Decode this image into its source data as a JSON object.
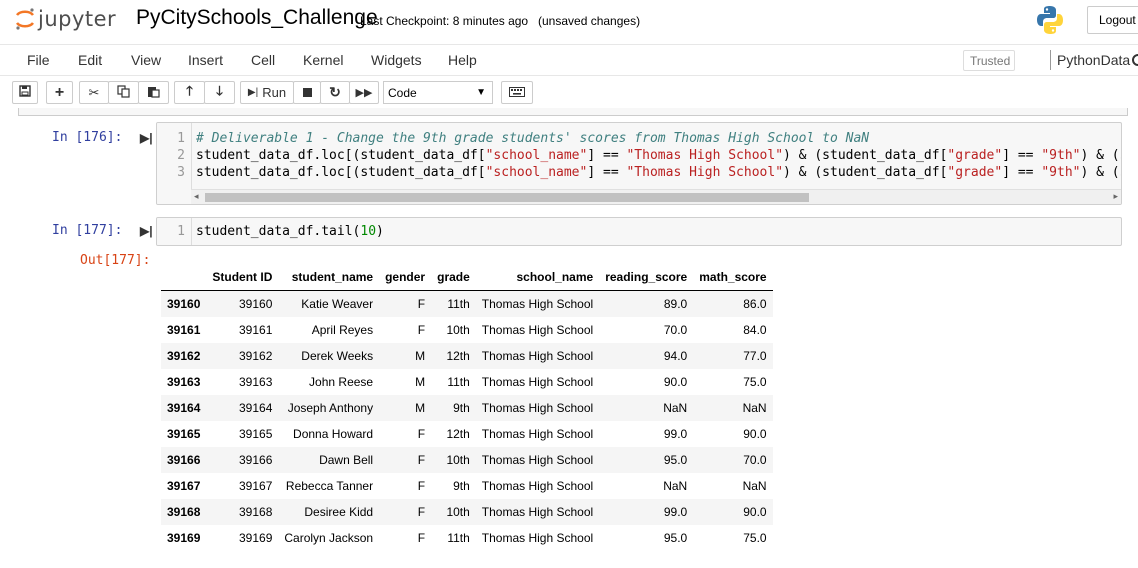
{
  "header": {
    "logo_text": "jupyter",
    "notebook_name": "PyCitySchools_Challenge",
    "checkpoint": "Last Checkpoint: 8 minutes ago",
    "unsaved": "(unsaved changes)",
    "logout": "Logout"
  },
  "menu": {
    "items": [
      "File",
      "Edit",
      "View",
      "Insert",
      "Cell",
      "Kernel",
      "Widgets",
      "Help"
    ],
    "trusted": "Trusted",
    "kernel_name": "PythonData"
  },
  "toolbar": {
    "run_label": "Run",
    "cell_type": "Code"
  },
  "cells": [
    {
      "prompt": "In [176]:",
      "line_numbers": [
        "1",
        "2",
        "3"
      ],
      "lines": [
        "# Deliverable 1 - Change the 9th grade students' scores from Thomas High School to NaN",
        "student_data_df.loc[(student_data_df[\"school_name\"] == \"Thomas High School\") & (student_data_df[\"grade\"] == \"9th\") & (stu",
        "student_data_df.loc[(student_data_df[\"school_name\"] == \"Thomas High School\") & (student_data_df[\"grade\"] == \"9th\") & (stu"
      ]
    },
    {
      "prompt": "In [177]:",
      "line_numbers": [
        "1"
      ],
      "lines": [
        "student_data_df.tail(10)"
      ],
      "out_prompt": "Out[177]:"
    }
  ],
  "table": {
    "columns": [
      "Student ID",
      "student_name",
      "gender",
      "grade",
      "school_name",
      "reading_score",
      "math_score"
    ],
    "rows": [
      [
        "39160",
        "39160",
        "Katie Weaver",
        "F",
        "11th",
        "Thomas High School",
        "89.0",
        "86.0"
      ],
      [
        "39161",
        "39161",
        "April Reyes",
        "F",
        "10th",
        "Thomas High School",
        "70.0",
        "84.0"
      ],
      [
        "39162",
        "39162",
        "Derek Weeks",
        "M",
        "12th",
        "Thomas High School",
        "94.0",
        "77.0"
      ],
      [
        "39163",
        "39163",
        "John Reese",
        "M",
        "11th",
        "Thomas High School",
        "90.0",
        "75.0"
      ],
      [
        "39164",
        "39164",
        "Joseph Anthony",
        "M",
        "9th",
        "Thomas High School",
        "NaN",
        "NaN"
      ],
      [
        "39165",
        "39165",
        "Donna Howard",
        "F",
        "12th",
        "Thomas High School",
        "99.0",
        "90.0"
      ],
      [
        "39166",
        "39166",
        "Dawn Bell",
        "F",
        "10th",
        "Thomas High School",
        "95.0",
        "70.0"
      ],
      [
        "39167",
        "39167",
        "Rebecca Tanner",
        "F",
        "9th",
        "Thomas High School",
        "NaN",
        "NaN"
      ],
      [
        "39168",
        "39168",
        "Desiree Kidd",
        "F",
        "10th",
        "Thomas High School",
        "99.0",
        "90.0"
      ],
      [
        "39169",
        "39169",
        "Carolyn Jackson",
        "F",
        "11th",
        "Thomas High School",
        "95.0",
        "75.0"
      ]
    ]
  },
  "colors": {
    "in_prompt": "#303f9f",
    "out_prompt": "#d84315",
    "comment": "#408080",
    "string": "#ba2121",
    "number": "#008800"
  }
}
